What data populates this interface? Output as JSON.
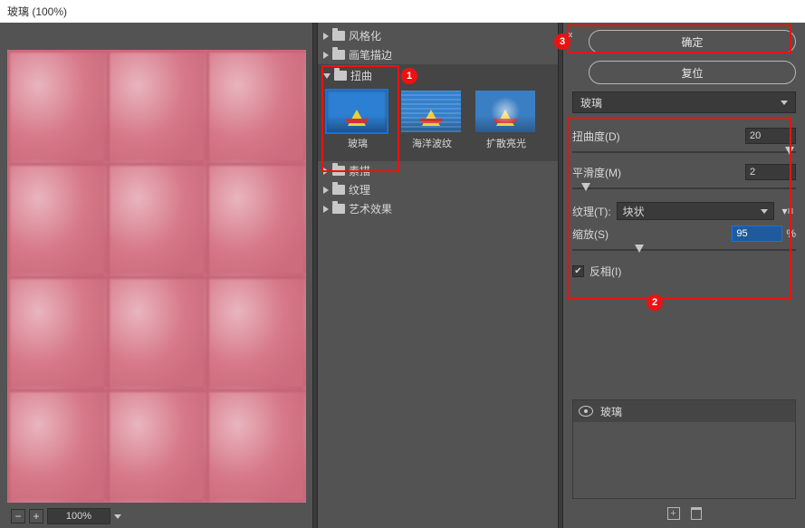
{
  "title": "玻璃 (100%)",
  "zoom": {
    "value": "100%"
  },
  "tree": {
    "stylize": "风格化",
    "brush": "画笔描边",
    "distort": "扭曲",
    "sketch": "素描",
    "texture": "纹理",
    "artistic": "艺术效果"
  },
  "thumbs": {
    "glass": "玻璃",
    "ocean": "海洋波纹",
    "diffuse": "扩散亮光"
  },
  "buttons": {
    "ok": "确定",
    "reset": "复位"
  },
  "filterSelect": "玻璃",
  "params": {
    "distortion": {
      "label": "扭曲度(D)",
      "value": "20",
      "pos": 97
    },
    "smooth": {
      "label": "平滑度(M)",
      "value": "2",
      "pos": 6
    },
    "texture": {
      "label": "纹理(T):",
      "value": "块状"
    },
    "scale": {
      "label": "缩放(S)",
      "value": "95",
      "unit": "%",
      "pos": 30
    },
    "invert": {
      "label": "反相(I)",
      "checked": true
    }
  },
  "layer": {
    "name": "玻璃"
  },
  "annotations": {
    "n1": "1",
    "n2": "2",
    "n3": "3"
  }
}
